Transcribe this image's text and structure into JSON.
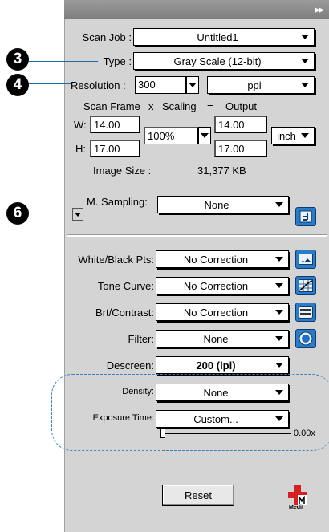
{
  "panel": {
    "scan_job": {
      "label": "Scan Job :",
      "value": "Untitled1"
    },
    "type": {
      "label": "Type :",
      "value": "Gray Scale (12-bit)"
    },
    "resolution": {
      "label": "Resolution :",
      "value": "300",
      "unit": "ppi"
    },
    "scan_frame_header": {
      "scan_frame": "Scan Frame",
      "x": "x",
      "scaling": "Scaling",
      "eq": "=",
      "output": "Output"
    },
    "width": {
      "label": "W:",
      "input": "14.00",
      "output": "14.00"
    },
    "height": {
      "label": "H:",
      "input": "17.00",
      "output": "17.00"
    },
    "scaling_value": "100%",
    "output_unit": "inch",
    "image_size": {
      "label": "Image Size :",
      "value": "31,377 KB"
    },
    "m_sampling": {
      "label": "M. Sampling:",
      "value": "None"
    },
    "white_black": {
      "label": "White/Black Pts:",
      "value": "No Correction"
    },
    "tone_curve": {
      "label": "Tone Curve:",
      "value": "No Correction"
    },
    "brt_contrast": {
      "label": "Brt/Contrast:",
      "value": "No Correction"
    },
    "filter": {
      "label": "Filter:",
      "value": "None"
    },
    "descreen": {
      "label": "Descreen:",
      "value": "200 (lpi)"
    },
    "density": {
      "label": "Density:",
      "value": "None"
    },
    "exposure": {
      "label": "Exposure Time:",
      "value": "Custom...",
      "slider_readout": "0.00x"
    },
    "reset_label": "Reset",
    "logo_text": "MediI"
  },
  "callouts": {
    "c3": "3",
    "c4": "4",
    "c6": "6"
  },
  "colors": {
    "panel": "#d4d4d4",
    "accent": "#2a7cc7",
    "leader": "#1a6aa8"
  }
}
